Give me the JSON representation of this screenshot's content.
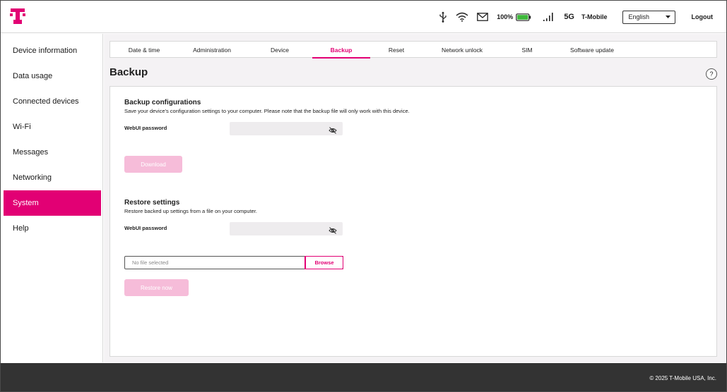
{
  "brand": {
    "accent": "#e20074",
    "logo_icon": "t-mobile-logo"
  },
  "header": {
    "battery_percent": "100%",
    "battery_level": 1.0,
    "network_type": "5G",
    "carrier": "T-Mobile",
    "language": "English",
    "logout_label": "Logout"
  },
  "sidebar": {
    "items": [
      {
        "label": "Device information"
      },
      {
        "label": "Data usage"
      },
      {
        "label": "Connected devices"
      },
      {
        "label": "Wi-Fi"
      },
      {
        "label": "Messages"
      },
      {
        "label": "Networking"
      },
      {
        "label": "System"
      },
      {
        "label": "Help"
      }
    ],
    "active": "System"
  },
  "tabs": [
    {
      "label": "Date & time"
    },
    {
      "label": "Administration"
    },
    {
      "label": "Device"
    },
    {
      "label": "Backup"
    },
    {
      "label": "Reset"
    },
    {
      "label": "Network unlock"
    },
    {
      "label": "SIM"
    },
    {
      "label": "Software update"
    }
  ],
  "page": {
    "title": "Backup",
    "help_label": "?"
  },
  "backup": {
    "title": "Backup configurations",
    "description": "Save your device's configuration settings to your computer. Please note that the backup file will only work with this device.",
    "password_label": "WebUI password",
    "password_value": "",
    "download_label": "Download"
  },
  "restore": {
    "title": "Restore settings",
    "description": "Restore backed up settings from a file on your computer.",
    "password_label": "WebUI password",
    "password_value": "",
    "file_placeholder": "No file selected",
    "browse_label": "Browse",
    "restore_label": "Restore now"
  },
  "footer": {
    "copyright": "© 2025 T-Mobile USA, Inc."
  }
}
